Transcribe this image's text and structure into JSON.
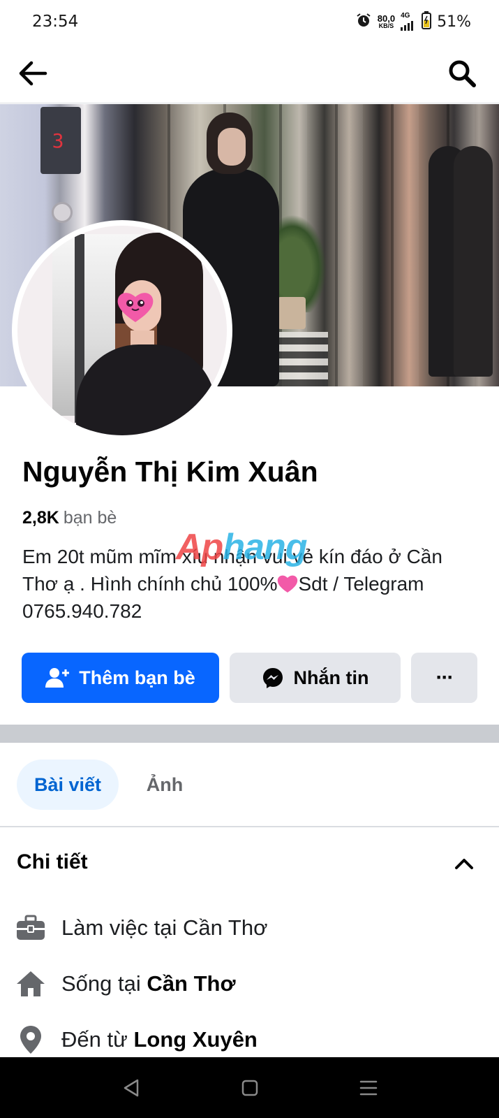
{
  "status_bar": {
    "time": "23:54",
    "net_speed_value": "80,0",
    "net_speed_unit": "KB/S",
    "network": "4G",
    "battery_percent": "51%"
  },
  "profile": {
    "name": "Nguyễn Thị Kim Xuân",
    "friends_count": "2,8K",
    "friends_label": "bạn bè",
    "bio_part1": "Em 20t mũm mĩm xíu nhận vui vẻ kín đáo ở Cần Thơ ạ . Hình chính chủ 100%",
    "bio_part2": "Sdt / Telegram 0765.940.782"
  },
  "watermark": {
    "part1": "Ap",
    "part2": "hang"
  },
  "actions": {
    "add_friend_label": "Thêm bạn bè",
    "message_label": "Nhắn tin",
    "more_label": "···"
  },
  "tabs": [
    {
      "label": "Bài viết",
      "active": true
    },
    {
      "label": "Ảnh",
      "active": false
    }
  ],
  "details": {
    "title": "Chi tiết",
    "work_text": "Làm việc tại Cần Thơ",
    "lives_prefix": "Sống tại",
    "lives_place": "Cần Thơ",
    "from_prefix": "Đến từ",
    "from_place": "Long Xuyên"
  },
  "icons": {
    "back": "arrow-left-icon",
    "search": "search-icon",
    "add_friend": "add-person-icon",
    "messenger": "messenger-icon",
    "work": "briefcase-icon",
    "home": "house-icon",
    "from": "location-pin-icon"
  },
  "colors": {
    "primary": "#0866ff",
    "secondary_button": "#e4e6eb",
    "active_tab_bg": "#ebf5ff",
    "active_tab_text": "#0064d1",
    "muted_text": "#65676b",
    "divider": "#c9ccd1"
  }
}
